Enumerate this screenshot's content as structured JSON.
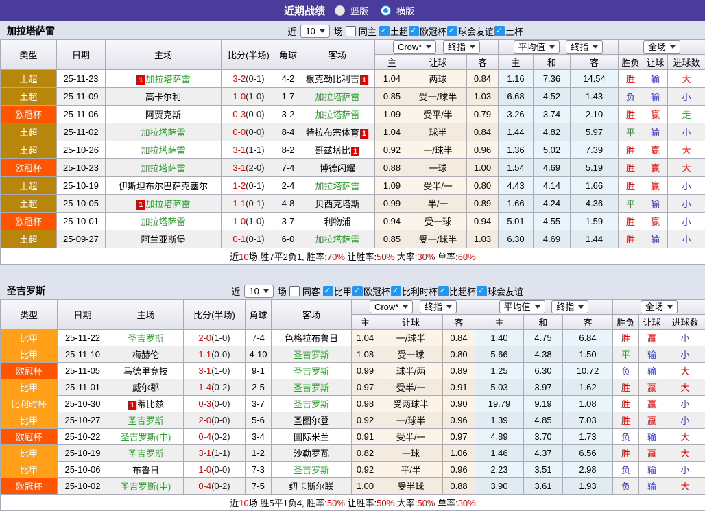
{
  "title_bar": {
    "title": "近期战绩",
    "radios": [
      {
        "label": "竖版",
        "selected": false
      },
      {
        "label": "横版",
        "selected": true
      }
    ]
  },
  "colors": {
    "accent_purple": "#4b3b9b",
    "page_background": "#dfe3ee",
    "win_red": "#e60000",
    "lose_blue": "#3333cc",
    "draw_green": "#1f9933",
    "team_green": "#2f9e2f"
  },
  "league_colors": {
    "土超": "#b8860b",
    "欧冠杯": "#ff5400",
    "比甲": "#ffa018",
    "比利时杯": "#ffa018"
  },
  "result_colors": {
    "胜": "#e60000",
    "平": "#1f9933",
    "负": "#3333cc",
    "赢": "#e60000",
    "输": "#3333cc",
    "大": "#e60000",
    "小": "#3333cc",
    "走": "#2f9e2f"
  },
  "column_headers": {
    "left": [
      "类型",
      "日期",
      "主场",
      "比分(半场)",
      "角球",
      "客场"
    ],
    "crow_select": "Crow*",
    "crow_ref_select": "终指",
    "avg_select": "平均值",
    "avg_ref_select": "终指",
    "full_select": "全场",
    "crow_cols": [
      "主",
      "让球",
      "客"
    ],
    "avg_cols": [
      "主",
      "和",
      "客"
    ],
    "full_cols": [
      "胜负",
      "让球",
      "进球数"
    ]
  },
  "tables": [
    {
      "team": "加拉塔萨雷",
      "filter": {
        "near_label": "近",
        "count": "10",
        "games_label": "场",
        "same_label": "同主",
        "same_checked": false,
        "leagues": [
          "土超",
          "欧冠杯",
          "球会友谊",
          "土杯"
        ]
      },
      "rows": [
        {
          "league": "土超",
          "date": "25-11-23",
          "home": {
            "name": "加拉塔萨雷",
            "green": true,
            "badge_pre": "1"
          },
          "score_full": "3-2",
          "score_half": "(0-1)",
          "corner": "4-2",
          "away": {
            "name": "根克勒比利吉",
            "green": false,
            "badge_post": "1"
          },
          "crow": [
            "1.04",
            "两球",
            "0.84"
          ],
          "avg": [
            "1.16",
            "7.36",
            "14.54"
          ],
          "outcome": [
            "胜",
            "输",
            "大"
          ]
        },
        {
          "league": "土超",
          "date": "25-11-09",
          "home": {
            "name": "高卡尔利",
            "green": false
          },
          "score_full": "1-0",
          "score_half": "(1-0)",
          "corner": "1-7",
          "away": {
            "name": "加拉塔萨雷",
            "green": true
          },
          "crow": [
            "0.85",
            "受一/球半",
            "1.03"
          ],
          "avg": [
            "6.68",
            "4.52",
            "1.43"
          ],
          "outcome": [
            "负",
            "输",
            "小"
          ]
        },
        {
          "league": "欧冠杯",
          "date": "25-11-06",
          "home": {
            "name": "阿贾克斯",
            "green": false
          },
          "score_full": "0-3",
          "score_half": "(0-0)",
          "corner": "3-2",
          "away": {
            "name": "加拉塔萨雷",
            "green": true
          },
          "crow": [
            "1.09",
            "受平/半",
            "0.79"
          ],
          "avg": [
            "3.26",
            "3.74",
            "2.10"
          ],
          "outcome": [
            "胜",
            "赢",
            "走"
          ]
        },
        {
          "league": "土超",
          "date": "25-11-02",
          "home": {
            "name": "加拉塔萨雷",
            "green": true
          },
          "score_full": "0-0",
          "score_half": "(0-0)",
          "corner": "8-4",
          "away": {
            "name": "特拉布宗体育",
            "green": false,
            "badge_post": "1"
          },
          "crow": [
            "1.04",
            "球半",
            "0.84"
          ],
          "avg": [
            "1.44",
            "4.82",
            "5.97"
          ],
          "outcome": [
            "平",
            "输",
            "小"
          ]
        },
        {
          "league": "土超",
          "date": "25-10-26",
          "home": {
            "name": "加拉塔萨雷",
            "green": true
          },
          "score_full": "3-1",
          "score_half": "(1-1)",
          "corner": "8-2",
          "away": {
            "name": "哥兹塔比",
            "green": false,
            "badge_post": "1"
          },
          "crow": [
            "0.92",
            "一/球半",
            "0.96"
          ],
          "avg": [
            "1.36",
            "5.02",
            "7.39"
          ],
          "outcome": [
            "胜",
            "赢",
            "大"
          ]
        },
        {
          "league": "欧冠杯",
          "date": "25-10-23",
          "home": {
            "name": "加拉塔萨雷",
            "green": true
          },
          "score_full": "3-1",
          "score_half": "(2-0)",
          "corner": "7-4",
          "away": {
            "name": "博德闪耀",
            "green": false
          },
          "crow": [
            "0.88",
            "一球",
            "1.00"
          ],
          "avg": [
            "1.54",
            "4.69",
            "5.19"
          ],
          "outcome": [
            "胜",
            "赢",
            "大"
          ]
        },
        {
          "league": "土超",
          "date": "25-10-19",
          "home": {
            "name": "伊斯坦布尔巴萨克塞尔",
            "green": false
          },
          "score_full": "1-2",
          "score_half": "(0-1)",
          "corner": "2-4",
          "away": {
            "name": "加拉塔萨雷",
            "green": true
          },
          "crow": [
            "1.09",
            "受半/一",
            "0.80"
          ],
          "avg": [
            "4.43",
            "4.14",
            "1.66"
          ],
          "outcome": [
            "胜",
            "赢",
            "小"
          ]
        },
        {
          "league": "土超",
          "date": "25-10-05",
          "home": {
            "name": "加拉塔萨雷",
            "green": true,
            "badge_pre": "1"
          },
          "score_full": "1-1",
          "score_half": "(0-1)",
          "corner": "4-8",
          "away": {
            "name": "贝西克塔斯",
            "green": false
          },
          "crow": [
            "0.99",
            "半/一",
            "0.89"
          ],
          "avg": [
            "1.66",
            "4.24",
            "4.36"
          ],
          "outcome": [
            "平",
            "输",
            "小"
          ]
        },
        {
          "league": "欧冠杯",
          "date": "25-10-01",
          "home": {
            "name": "加拉塔萨雷",
            "green": true
          },
          "score_full": "1-0",
          "score_half": "(1-0)",
          "corner": "3-7",
          "away": {
            "name": "利物浦",
            "green": false
          },
          "crow": [
            "0.94",
            "受一球",
            "0.94"
          ],
          "avg": [
            "5.01",
            "4.55",
            "1.59"
          ],
          "outcome": [
            "胜",
            "赢",
            "小"
          ]
        },
        {
          "league": "土超",
          "date": "25-09-27",
          "home": {
            "name": "阿兰亚斯堡",
            "green": false
          },
          "score_full": "0-1",
          "score_half": "(0-1)",
          "corner": "6-0",
          "away": {
            "name": "加拉塔萨雷",
            "green": true
          },
          "crow": [
            "0.85",
            "受一/球半",
            "1.03"
          ],
          "avg": [
            "6.30",
            "4.69",
            "1.44"
          ],
          "outcome": [
            "胜",
            "输",
            "小"
          ]
        }
      ],
      "summary": [
        [
          "近",
          "k"
        ],
        [
          "10",
          "r"
        ],
        [
          "场,胜7平2负1, 胜率:",
          "k"
        ],
        [
          "70%",
          "r"
        ],
        [
          " 让胜率:",
          "k"
        ],
        [
          "50%",
          "r"
        ],
        [
          " 大率:",
          "k"
        ],
        [
          "30%",
          "r"
        ],
        [
          " 单率:",
          "k"
        ],
        [
          "60%",
          "r"
        ]
      ]
    },
    {
      "team": "圣吉罗斯",
      "filter": {
        "near_label": "近",
        "count": "10",
        "games_label": "场",
        "same_label": "同客",
        "same_checked": false,
        "leagues": [
          "比甲",
          "欧冠杯",
          "比利时杯",
          "比超杯",
          "球会友谊"
        ]
      },
      "rows": [
        {
          "league": "比甲",
          "date": "25-11-22",
          "home": {
            "name": "圣吉罗斯",
            "green": true
          },
          "score_full": "2-0",
          "score_half": "(1-0)",
          "corner": "7-4",
          "away": {
            "name": "色格拉布鲁日",
            "green": false
          },
          "crow": [
            "1.04",
            "一/球半",
            "0.84"
          ],
          "avg": [
            "1.40",
            "4.75",
            "6.84"
          ],
          "outcome": [
            "胜",
            "赢",
            "小"
          ]
        },
        {
          "league": "比甲",
          "date": "25-11-10",
          "home": {
            "name": "梅赫伦",
            "green": false
          },
          "score_full": "1-1",
          "score_half": "(0-0)",
          "corner": "4-10",
          "away": {
            "name": "圣吉罗斯",
            "green": true
          },
          "crow": [
            "1.08",
            "受一球",
            "0.80"
          ],
          "avg": [
            "5.66",
            "4.38",
            "1.50"
          ],
          "outcome": [
            "平",
            "输",
            "小"
          ]
        },
        {
          "league": "欧冠杯",
          "date": "25-11-05",
          "home": {
            "name": "马德里竞技",
            "green": false
          },
          "score_full": "3-1",
          "score_half": "(1-0)",
          "corner": "9-1",
          "away": {
            "name": "圣吉罗斯",
            "green": true
          },
          "crow": [
            "0.99",
            "球半/两",
            "0.89"
          ],
          "avg": [
            "1.25",
            "6.30",
            "10.72"
          ],
          "outcome": [
            "负",
            "输",
            "大"
          ]
        },
        {
          "league": "比甲",
          "date": "25-11-01",
          "home": {
            "name": "威尔郡",
            "green": false
          },
          "score_full": "1-4",
          "score_half": "(0-2)",
          "corner": "2-5",
          "away": {
            "name": "圣吉罗斯",
            "green": true
          },
          "crow": [
            "0.97",
            "受半/一",
            "0.91"
          ],
          "avg": [
            "5.03",
            "3.97",
            "1.62"
          ],
          "outcome": [
            "胜",
            "赢",
            "大"
          ]
        },
        {
          "league": "比利时杯",
          "date": "25-10-30",
          "home": {
            "name": "蒂比兹",
            "green": false,
            "badge_pre": "1"
          },
          "score_full": "0-3",
          "score_half": "(0-0)",
          "corner": "3-7",
          "away": {
            "name": "圣吉罗斯",
            "green": true
          },
          "crow": [
            "0.98",
            "受两球半",
            "0.90"
          ],
          "avg": [
            "19.79",
            "9.19",
            "1.08"
          ],
          "outcome": [
            "胜",
            "赢",
            "小"
          ]
        },
        {
          "league": "比甲",
          "date": "25-10-27",
          "home": {
            "name": "圣吉罗斯",
            "green": true
          },
          "score_full": "2-0",
          "score_half": "(0-0)",
          "corner": "5-6",
          "away": {
            "name": "圣图尔登",
            "green": false
          },
          "crow": [
            "0.92",
            "一/球半",
            "0.96"
          ],
          "avg": [
            "1.39",
            "4.85",
            "7.03"
          ],
          "outcome": [
            "胜",
            "赢",
            "小"
          ]
        },
        {
          "league": "欧冠杯",
          "date": "25-10-22",
          "home": {
            "name": "圣吉罗斯(中)",
            "green": true
          },
          "score_full": "0-4",
          "score_half": "(0-2)",
          "corner": "3-4",
          "away": {
            "name": "国际米兰",
            "green": false
          },
          "crow": [
            "0.91",
            "受半/一",
            "0.97"
          ],
          "avg": [
            "4.89",
            "3.70",
            "1.73"
          ],
          "outcome": [
            "负",
            "输",
            "大"
          ]
        },
        {
          "league": "比甲",
          "date": "25-10-19",
          "home": {
            "name": "圣吉罗斯",
            "green": true
          },
          "score_full": "3-1",
          "score_half": "(1-1)",
          "corner": "1-2",
          "away": {
            "name": "沙勒罗瓦",
            "green": false
          },
          "crow": [
            "0.82",
            "一球",
            "1.06"
          ],
          "avg": [
            "1.46",
            "4.37",
            "6.56"
          ],
          "outcome": [
            "胜",
            "赢",
            "大"
          ]
        },
        {
          "league": "比甲",
          "date": "25-10-06",
          "home": {
            "name": "布鲁日",
            "green": false
          },
          "score_full": "1-0",
          "score_half": "(0-0)",
          "corner": "7-3",
          "away": {
            "name": "圣吉罗斯",
            "green": true
          },
          "crow": [
            "0.92",
            "平/半",
            "0.96"
          ],
          "avg": [
            "2.23",
            "3.51",
            "2.98"
          ],
          "outcome": [
            "负",
            "输",
            "小"
          ]
        },
        {
          "league": "欧冠杯",
          "date": "25-10-02",
          "home": {
            "name": "圣吉罗斯(中)",
            "green": true
          },
          "score_full": "0-4",
          "score_half": "(0-2)",
          "corner": "7-5",
          "away": {
            "name": "纽卡斯尔联",
            "green": false
          },
          "crow": [
            "1.00",
            "受半球",
            "0.88"
          ],
          "avg": [
            "3.90",
            "3.61",
            "1.93"
          ],
          "outcome": [
            "负",
            "输",
            "大"
          ]
        }
      ],
      "summary": [
        [
          "近",
          "k"
        ],
        [
          "10",
          "r"
        ],
        [
          "场,胜5平1负4, 胜率:",
          "k"
        ],
        [
          "50%",
          "r"
        ],
        [
          " 让胜率:",
          "k"
        ],
        [
          "50%",
          "r"
        ],
        [
          " 大率:",
          "k"
        ],
        [
          "50%",
          "r"
        ],
        [
          " 单率:",
          "k"
        ],
        [
          "30%",
          "r"
        ]
      ]
    }
  ]
}
